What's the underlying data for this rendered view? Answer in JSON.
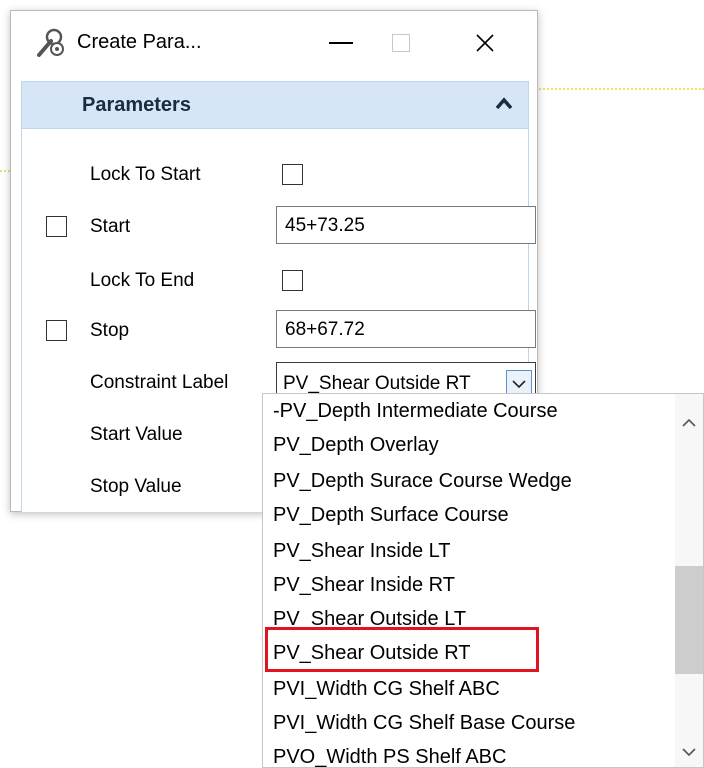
{
  "window": {
    "title": "Create Para...",
    "controls": {
      "minimize": "minimize",
      "maximize": "maximize",
      "close": "✕"
    }
  },
  "panel": {
    "title": "Parameters",
    "lock_to_start": {
      "label": "Lock To Start",
      "checked": false
    },
    "start": {
      "label": "Start",
      "value": "45+73.25",
      "checked": false
    },
    "lock_to_end": {
      "label": "Lock To End",
      "checked": false
    },
    "stop": {
      "label": "Stop",
      "value": "68+67.72",
      "checked": false
    },
    "constraint_label": {
      "label": "Constraint Label",
      "value": "PV_Shear Outside RT"
    },
    "start_value": {
      "label": "Start Value"
    },
    "stop_value": {
      "label": "Stop Value"
    }
  },
  "dropdown": {
    "items": [
      "-PV_Depth Intermediate Course",
      "PV_Depth Overlay",
      "PV_Depth Surace Course Wedge",
      "PV_Depth Surface Course",
      "PV_Shear Inside LT",
      "PV_Shear Inside RT",
      "PV_Shear Outside LT",
      "PV_Shear Outside RT",
      "PVI_Width CG Shelf ABC",
      "PVI_Width CG Shelf Base Course",
      "PVO_Width PS Shelf ABC"
    ],
    "highlighted": "PV_Shear Outside RT"
  },
  "colors": {
    "panel_header_bg": "#d7e6f6",
    "highlight_border": "#e0141e",
    "trace": "#e8e46a"
  },
  "icons": {
    "title": "wrench-gear-icon",
    "collapse": "chevron-up-icon",
    "combo_button": "chevron-down-icon",
    "scroll_up": "chevron-up-icon",
    "scroll_down": "chevron-down-icon"
  }
}
